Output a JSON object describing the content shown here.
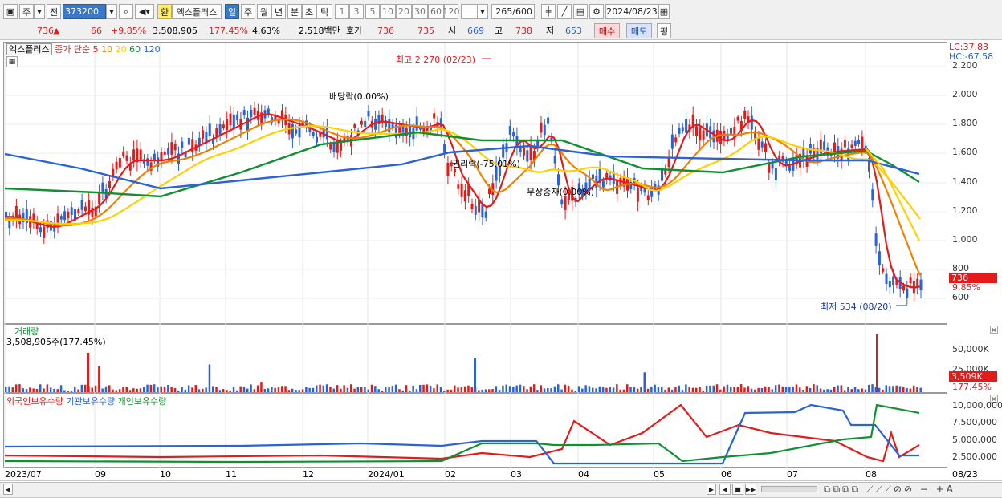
{
  "toolbar": {
    "tab1": "주",
    "tab2": "전",
    "code": "373200",
    "hwan": "환",
    "name": "엑스플러스",
    "periods": [
      "일",
      "주",
      "월",
      "년",
      "분",
      "초",
      "틱"
    ],
    "minutes": [
      "1",
      "3",
      "5",
      "10",
      "20",
      "30",
      "60",
      "120"
    ],
    "count": "265",
    "count_total": "/600",
    "date": "2024/08/23"
  },
  "quote": {
    "price": "736",
    "arrow": "▲",
    "change": "66",
    "change_pct": "+9.85%",
    "volume": "3,508,905",
    "vol_ratio": "177.45%",
    "turnover": "4.63%",
    "amount": "2,518백만",
    "hoga_label": "호가",
    "ask": "736",
    "bid": "735",
    "open_label": "시",
    "open": "669",
    "high_label": "고",
    "high": "738",
    "low_label": "저",
    "low": "653",
    "buy": "매수",
    "sell": "매도",
    "eval": "평"
  },
  "price_panel": {
    "stock": "엑스플러스",
    "legend_prefix": "종가 단순",
    "ma": [
      {
        "label": "5",
        "color": "#e31b1b"
      },
      {
        "label": "10",
        "color": "#f08000"
      },
      {
        "label": "20",
        "color": "#ffd000"
      },
      {
        "label": "60",
        "color": "#119033"
      },
      {
        "label": "120",
        "color": "#2a62d8"
      }
    ],
    "lc": "LC:37.83",
    "hc": "HC:-67.58",
    "yticks": [
      "2,200",
      "2,000",
      "1,800",
      "1,600",
      "1,400",
      "1,200",
      "1,000",
      "800",
      "600"
    ],
    "cur_price": "736",
    "cur_pct": "9.85%",
    "annotations": {
      "high": "최고 2,270 (02/23)",
      "low": "최저 534 (08/20)",
      "div": "배당락(0.00%)",
      "reduce": "권리락(-75.01%)",
      "bonus": "무상증자(0.00%)"
    }
  },
  "volume_panel": {
    "title": "거래량",
    "value": "3,508,905주(177.45%)",
    "yticks": [
      "50,000K",
      "25,000K"
    ],
    "cur": "3,509K",
    "cur_pct": "177.45%"
  },
  "holdings_panel": {
    "legends": [
      {
        "label": "외국인보유수량",
        "color": "#e31b1b"
      },
      {
        "label": "기관보유수량",
        "color": "#2a62d8"
      },
      {
        "label": "개인보유수량",
        "color": "#119033"
      }
    ],
    "yticks": [
      "10,000,000",
      "7,500,000",
      "5,000,000",
      "2,500,000"
    ]
  },
  "xaxis": {
    "labels": [
      "2023/07",
      "09",
      "10",
      "11",
      "12",
      "2024/01",
      "02",
      "03",
      "04",
      "05",
      "06",
      "07",
      "08"
    ],
    "end": "08/23"
  },
  "colors": {
    "up": "#e31b1b",
    "down": "#2a62d8"
  }
}
